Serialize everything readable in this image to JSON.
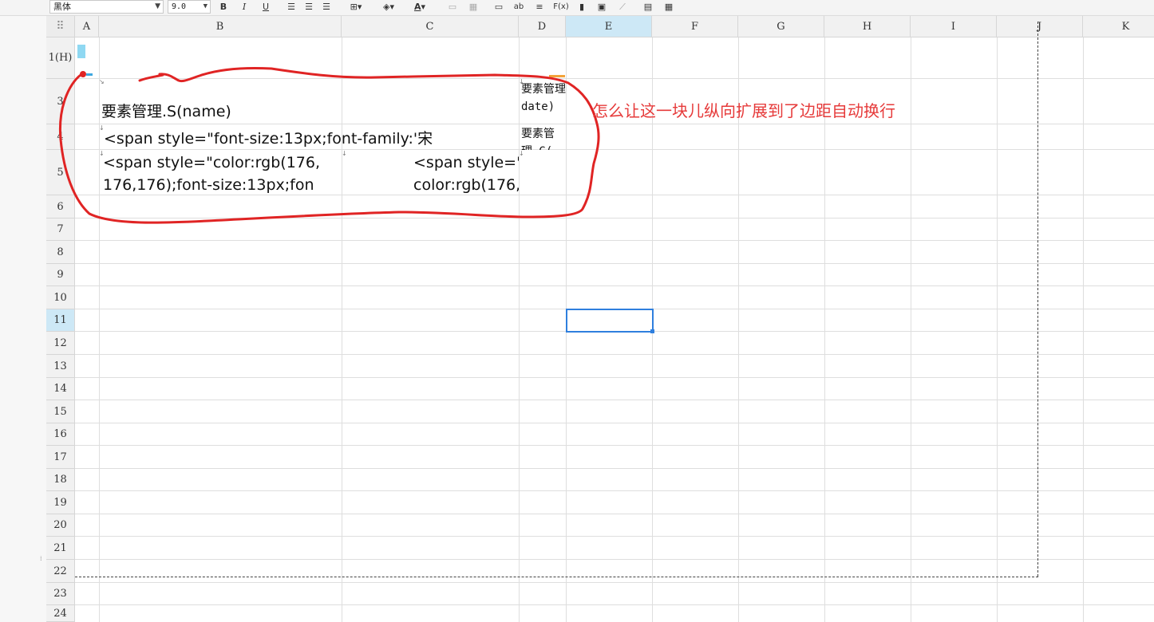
{
  "toolbar": {
    "font_name": "黑体",
    "font_size": "9.0",
    "bold": "B",
    "italic": "I",
    "underline": "U",
    "text_color_glyph": "A",
    "formula_glyph": "F(x)",
    "ab_glyph": "ab"
  },
  "columns": [
    "A",
    "B",
    "C",
    "D",
    "E",
    "F",
    "G",
    "H",
    "I",
    "J",
    "K"
  ],
  "selected_column": "E",
  "rows": [
    "1(H)",
    "3",
    "4",
    "5",
    "6",
    "7",
    "8",
    "9",
    "10",
    "11",
    "12",
    "13",
    "14",
    "15",
    "16",
    "17",
    "18",
    "19",
    "20",
    "21",
    "22",
    "23",
    "24"
  ],
  "selected_row": "11",
  "cells": {
    "b3": "要素管理.S(name)",
    "b4": "<span style=\"font-size:13px;font-family:'宋",
    "b5": "<span style=\"color:rgb(176,\n176,176);font-size:13px;fon",
    "c5": "<span style=\"\ncolor:rgb(176,",
    "d3": "要素管理.G(\ndate)",
    "d4": "要素管理.G("
  },
  "annotation": "怎么让这一块儿纵向扩展到了边距自动换行",
  "colors": {
    "annotation": "#e63a3a",
    "selection": "#2f7fde",
    "header_selected": "#cde8f6"
  }
}
